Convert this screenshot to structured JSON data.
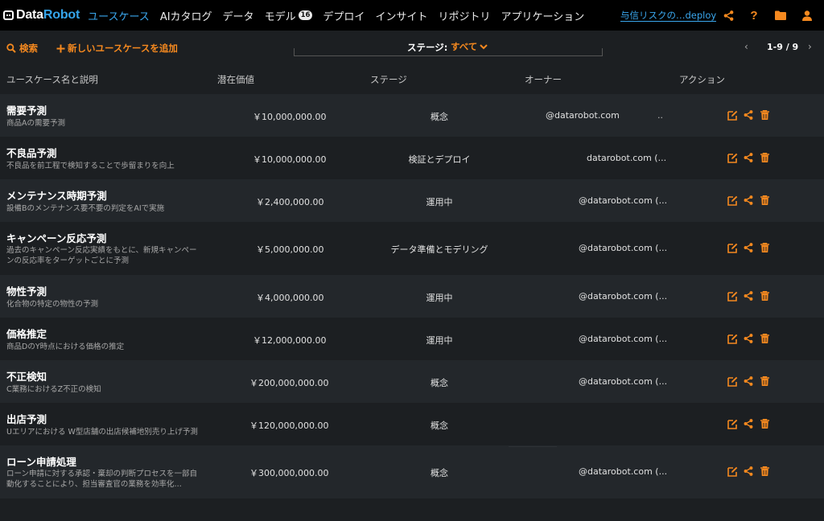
{
  "brand": {
    "part1": "Data",
    "part2": "Robot"
  },
  "nav": {
    "items": [
      {
        "label": "ユースケース",
        "active": true
      },
      {
        "label": "AIカタログ"
      },
      {
        "label": "データ"
      },
      {
        "label": "モデル",
        "badge": "16"
      },
      {
        "label": "デプロイ"
      },
      {
        "label": "インサイト"
      },
      {
        "label": "リポジトリ"
      },
      {
        "label": "アプリケーション"
      }
    ],
    "deploy_link": "与信リスクの…deploy"
  },
  "toolbar": {
    "search_label": "検索",
    "add_label": "新しいユースケースを追加",
    "stage_label": "ステージ:",
    "stage_value": "すべて",
    "pagination": "1-9 / 9"
  },
  "table": {
    "headers": [
      "ユースケース名と説明",
      "潜在価値",
      "ステージ",
      "オーナー",
      "アクション"
    ],
    "rows": [
      {
        "name": "需要予測",
        "desc": "商品Aの需要予測",
        "value": "￥10,000,000.00",
        "stage": "概念",
        "owner": "@datarobot.com",
        "owner_extra": ".."
      },
      {
        "name": "不良品予測",
        "desc": "不良品を前工程で検知することで歩留まりを向上",
        "value": "￥10,000,000.00",
        "stage": "検証とデプロイ",
        "owner": "datarobot.com (...",
        "owner_extra": ""
      },
      {
        "name": "メンテナンス時期予測",
        "desc": "設備Bのメンテナンス要不要の判定をAIで実施",
        "value": "￥2,400,000.00",
        "stage": "運用中",
        "owner": "@datarobot.com (...",
        "owner_extra": ""
      },
      {
        "name": "キャンペーン反応予測",
        "desc": "過去のキャンペーン反応実績をもとに、新規キャンペーンの反応率をターゲットごとに予測",
        "value": "￥5,000,000.00",
        "stage": "データ準備とモデリング",
        "owner": "@datarobot.com (...",
        "owner_extra": ""
      },
      {
        "name": "物性予測",
        "desc": "化合物の特定の物性の予測",
        "value": "￥4,000,000.00",
        "stage": "運用中",
        "owner": "@datarobot.com (...",
        "owner_extra": ""
      },
      {
        "name": "価格推定",
        "desc": "商品DのY時点における価格の推定",
        "value": "￥12,000,000.00",
        "stage": "運用中",
        "owner": "@datarobot.com (...",
        "owner_extra": ""
      },
      {
        "name": "不正検知",
        "desc": "C業務におけるZ不正の検知",
        "value": "￥200,000,000.00",
        "stage": "概念",
        "owner": "@datarobot.com (...",
        "owner_extra": ""
      },
      {
        "name": "出店予測",
        "desc": "Uエリアにおける W型店舗の出店候補地別売り上げ予測",
        "value": "￥120,000,000.00",
        "stage": "概念",
        "owner": "",
        "owner_extra": ""
      },
      {
        "name": "ローン申請処理",
        "desc": "ローン申請に対する承認・棄却の判断プロセスを一部自動化することにより、担当審査官の業務を効率化…",
        "value": "￥300,000,000.00",
        "stage": "概念",
        "owner": "@datarobot.com (...",
        "owner_extra": ""
      }
    ]
  },
  "colors": {
    "accent": "#f5891f",
    "link": "#3aa7ee",
    "row_odd": "#23272b",
    "row_even": "#1c1f22"
  }
}
